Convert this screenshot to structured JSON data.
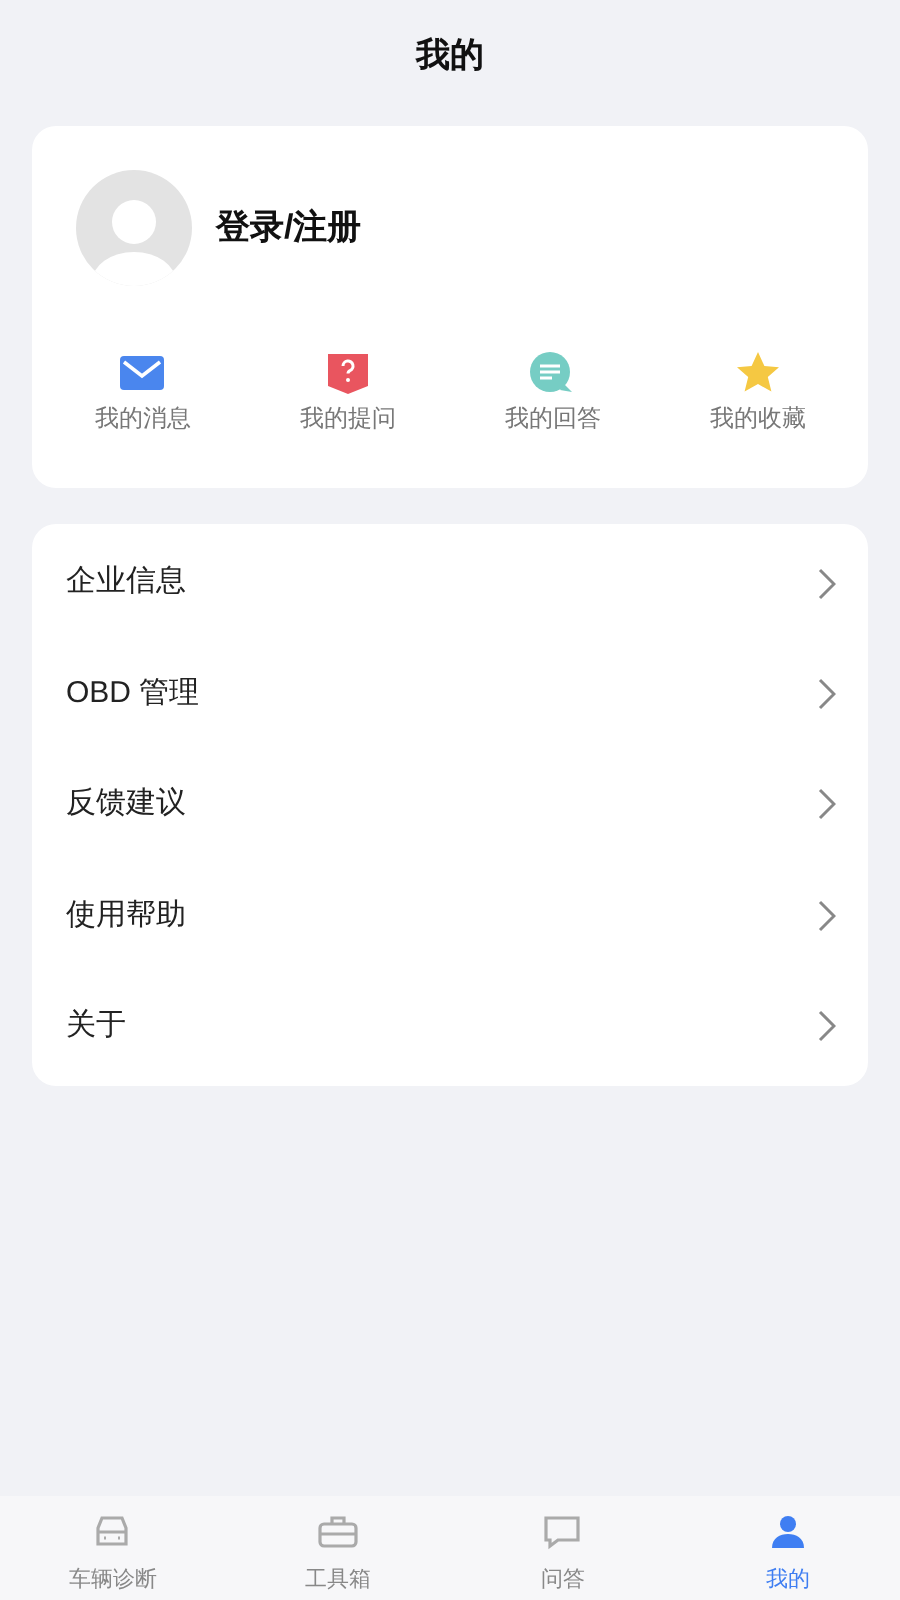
{
  "header": {
    "title": "我的"
  },
  "profile": {
    "login_label": "登录/注册"
  },
  "shortcuts": [
    {
      "kind": "message",
      "label": "我的消息"
    },
    {
      "kind": "question",
      "label": "我的提问"
    },
    {
      "kind": "answer",
      "label": "我的回答"
    },
    {
      "kind": "favorite",
      "label": "我的收藏"
    }
  ],
  "menu": [
    {
      "label": "企业信息"
    },
    {
      "label": "OBD 管理"
    },
    {
      "label": "反馈建议"
    },
    {
      "label": "使用帮助"
    },
    {
      "label": "关于"
    }
  ],
  "tab_bar": [
    {
      "kind": "car",
      "label": "车辆诊断",
      "selected": false
    },
    {
      "kind": "toolbox",
      "label": "工具箱",
      "selected": false
    },
    {
      "kind": "qa",
      "label": "问答",
      "selected": false
    },
    {
      "kind": "me",
      "label": "我的",
      "selected": true
    }
  ]
}
